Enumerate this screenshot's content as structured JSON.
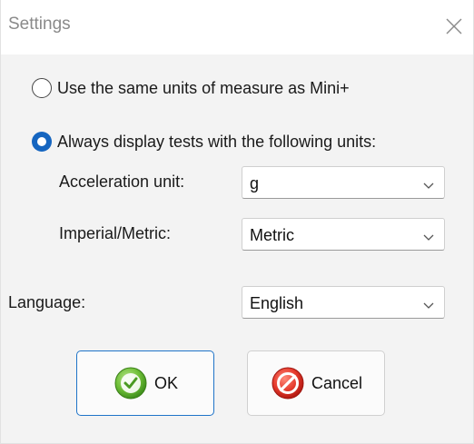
{
  "window": {
    "title": "Settings",
    "close_icon": "close-icon"
  },
  "units_options": {
    "same_as_device_label": "Use the same units of measure as Mini+",
    "same_as_device_selected": false,
    "always_display_label": "Always display tests with the following units:",
    "always_display_selected": true
  },
  "acceleration": {
    "label": "Acceleration unit:",
    "value": "g"
  },
  "imperial_metric": {
    "label": "Imperial/Metric:",
    "value": "Metric"
  },
  "language": {
    "label": "Language:",
    "value": "English"
  },
  "buttons": {
    "ok_label": "OK",
    "ok_icon": "check-circle-icon",
    "cancel_label": "Cancel",
    "cancel_icon": "no-entry-icon"
  },
  "colors": {
    "accent": "#1565c0",
    "ok_icon_green": "#5aa82a",
    "cancel_icon_red": "#d8261d"
  }
}
